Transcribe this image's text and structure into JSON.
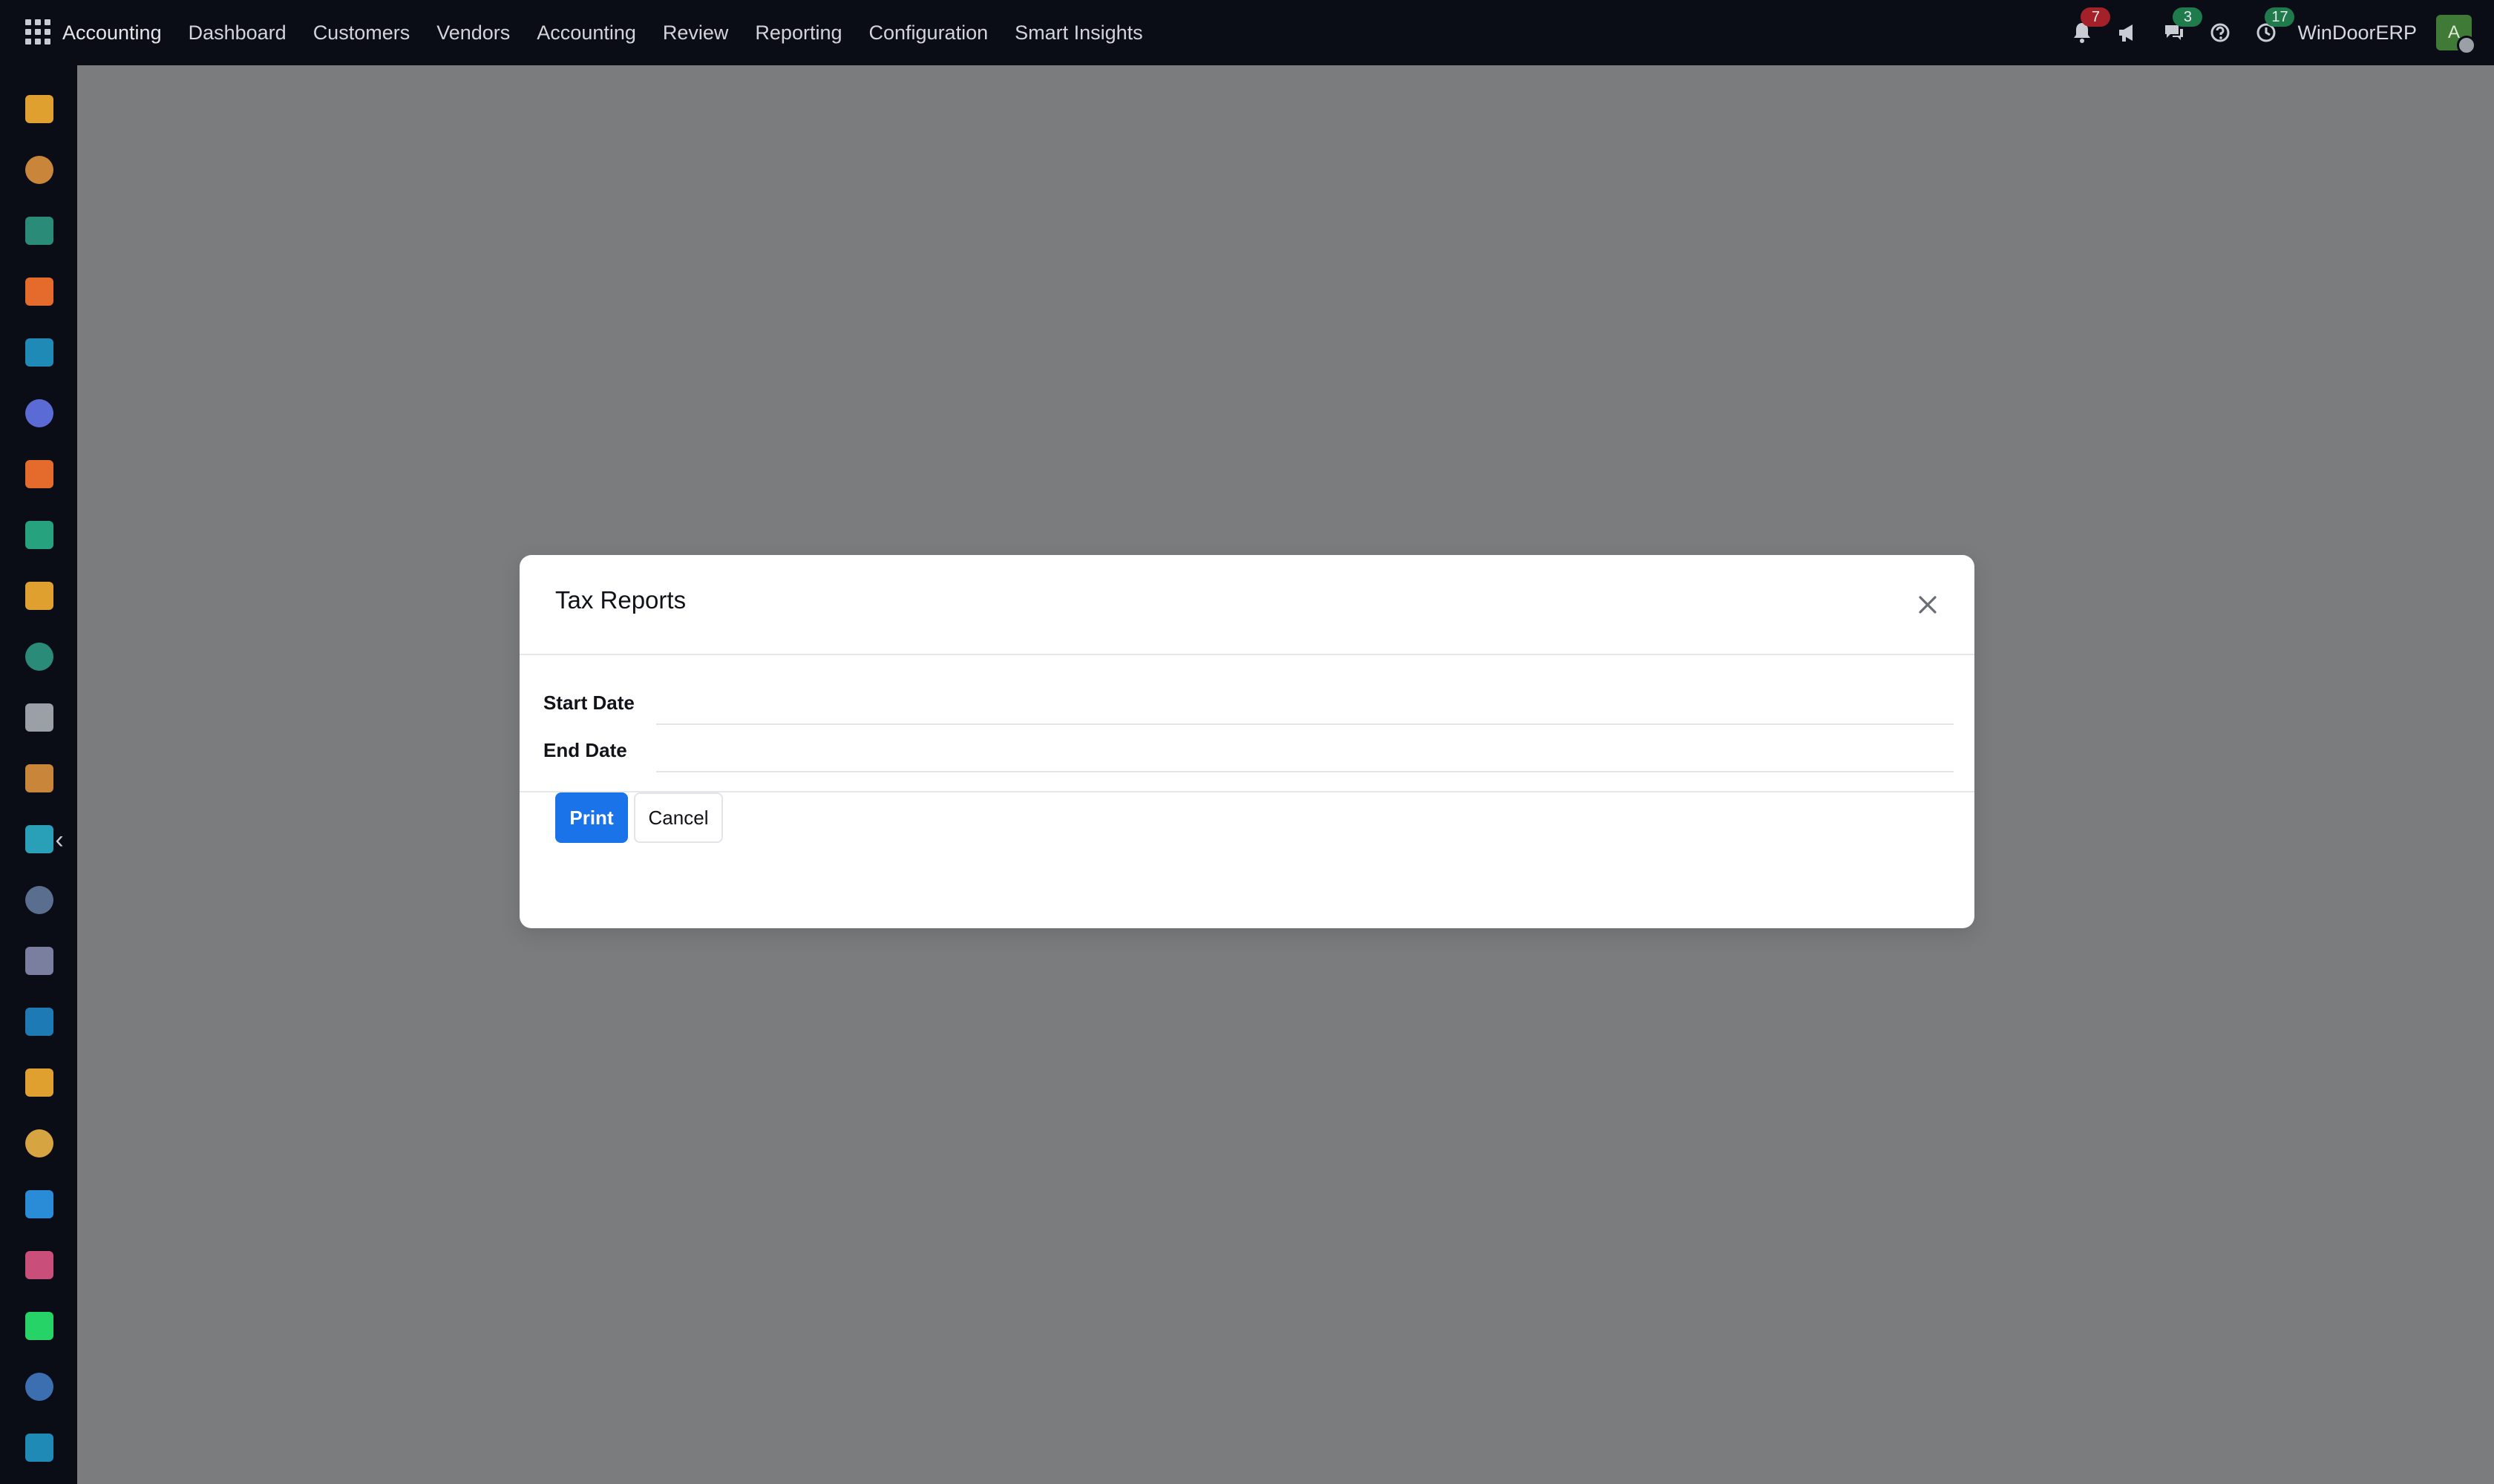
{
  "top_menu": {
    "app_name": "Accounting",
    "items": [
      "Dashboard",
      "Customers",
      "Vendors",
      "Accounting",
      "Review",
      "Reporting",
      "Configuration",
      "Smart Insights"
    ]
  },
  "systray": {
    "notifications_count": "7",
    "messages_count": "3",
    "activities_count": "17",
    "company": "WinDoorERP",
    "avatar_initial": "A"
  },
  "dialog": {
    "title": "Tax Reports",
    "fields": [
      {
        "label": "Start Date",
        "value": ""
      },
      {
        "label": "End Date",
        "value": ""
      }
    ],
    "print_label": "Print",
    "cancel_label": "Cancel"
  },
  "app_icons": [
    {
      "name": "sales-app-icon",
      "color": "#e0a030"
    },
    {
      "name": "crm-app-icon",
      "color": "#c9863a"
    },
    {
      "name": "contacts-app-icon",
      "color": "#2a8b78"
    },
    {
      "name": "discuss-app-icon",
      "color": "#e46b2b"
    },
    {
      "name": "website-app-icon",
      "color": "#1e8ab5"
    },
    {
      "name": "email-marketing-app-icon",
      "color": "#5a6bd6"
    },
    {
      "name": "livechat-app-icon",
      "color": "#e46b2b"
    },
    {
      "name": "documents-app-icon",
      "color": "#26a37e"
    },
    {
      "name": "reporting-app-icon",
      "color": "#e0a030"
    },
    {
      "name": "employees-app-icon",
      "color": "#2a8b78"
    },
    {
      "name": "inventory-app-icon",
      "color": "#9aa0a6"
    },
    {
      "name": "project-app-icon",
      "color": "#c9863a"
    },
    {
      "name": "tasks-app-icon",
      "color": "#2a9fb8"
    },
    {
      "name": "knowledge-app-icon",
      "color": "#5a6f8f"
    },
    {
      "name": "product-app-icon",
      "color": "#7a7fa0"
    },
    {
      "name": "invoicing-app-icon",
      "color": "#1e7ab5"
    },
    {
      "name": "team-app-icon",
      "color": "#e0a030"
    },
    {
      "name": "calendar-app-icon",
      "color": "#d6a542"
    },
    {
      "name": "sign-app-icon",
      "color": "#2a8bd6"
    },
    {
      "name": "dashboard-app-icon",
      "color": "#c94f7a"
    },
    {
      "name": "whatsapp-app-icon",
      "color": "#25d366"
    },
    {
      "name": "timesheet-app-icon",
      "color": "#3b6fb0"
    },
    {
      "name": "website-builder-app-icon",
      "color": "#1e8ab5"
    }
  ]
}
